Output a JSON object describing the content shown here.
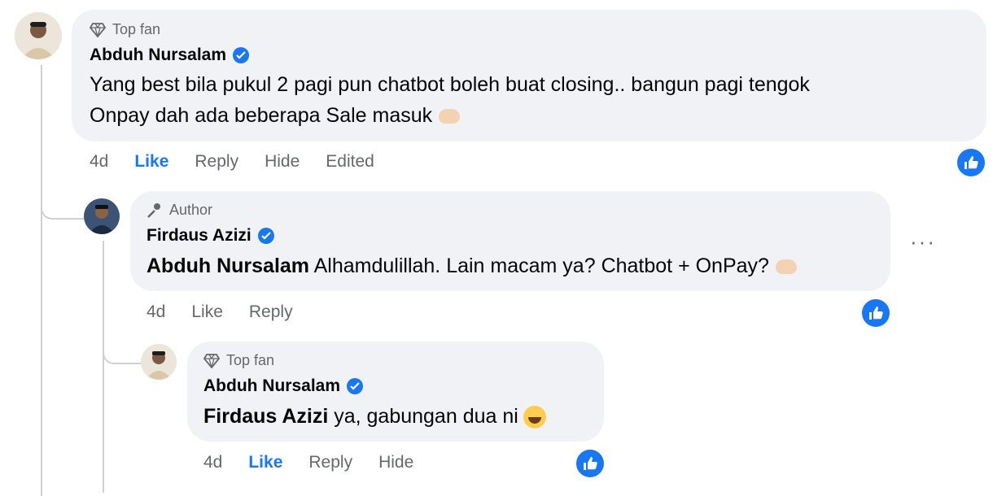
{
  "comment1": {
    "badge": "Top fan",
    "name": "Abduh Nursalam",
    "text_line1": "Yang best bila pukul 2 pagi pun chatbot boleh buat closing.. bangun pagi tengok",
    "text_line2": "Onpay dah ada beberapa Sale masuk",
    "time": "4d",
    "like": "Like",
    "reply": "Reply",
    "hide": "Hide",
    "edited": "Edited"
  },
  "reply1": {
    "badge": "Author",
    "name": "Firdaus Azizi",
    "mention": "Abduh Nursalam",
    "text": "Alhamdulillah. Lain macam ya? Chatbot + OnPay?",
    "time": "4d",
    "like": "Like",
    "reply": "Reply",
    "more": "···"
  },
  "reply2": {
    "badge": "Top fan",
    "name": "Abduh Nursalam",
    "mention": "Firdaus Azizi",
    "text": "ya, gabungan dua ni",
    "time": "4d",
    "like": "Like",
    "reply": "Reply",
    "hide": "Hide"
  },
  "colors": {
    "accent": "#1877f2",
    "bubble": "#f0f2f5",
    "muted": "#65676b"
  },
  "icons": [
    "diamond-icon",
    "microphone-icon",
    "verified-icon",
    "like-reaction-icon",
    "more-options-icon",
    "hands-emoji",
    "smile-emoji"
  ]
}
